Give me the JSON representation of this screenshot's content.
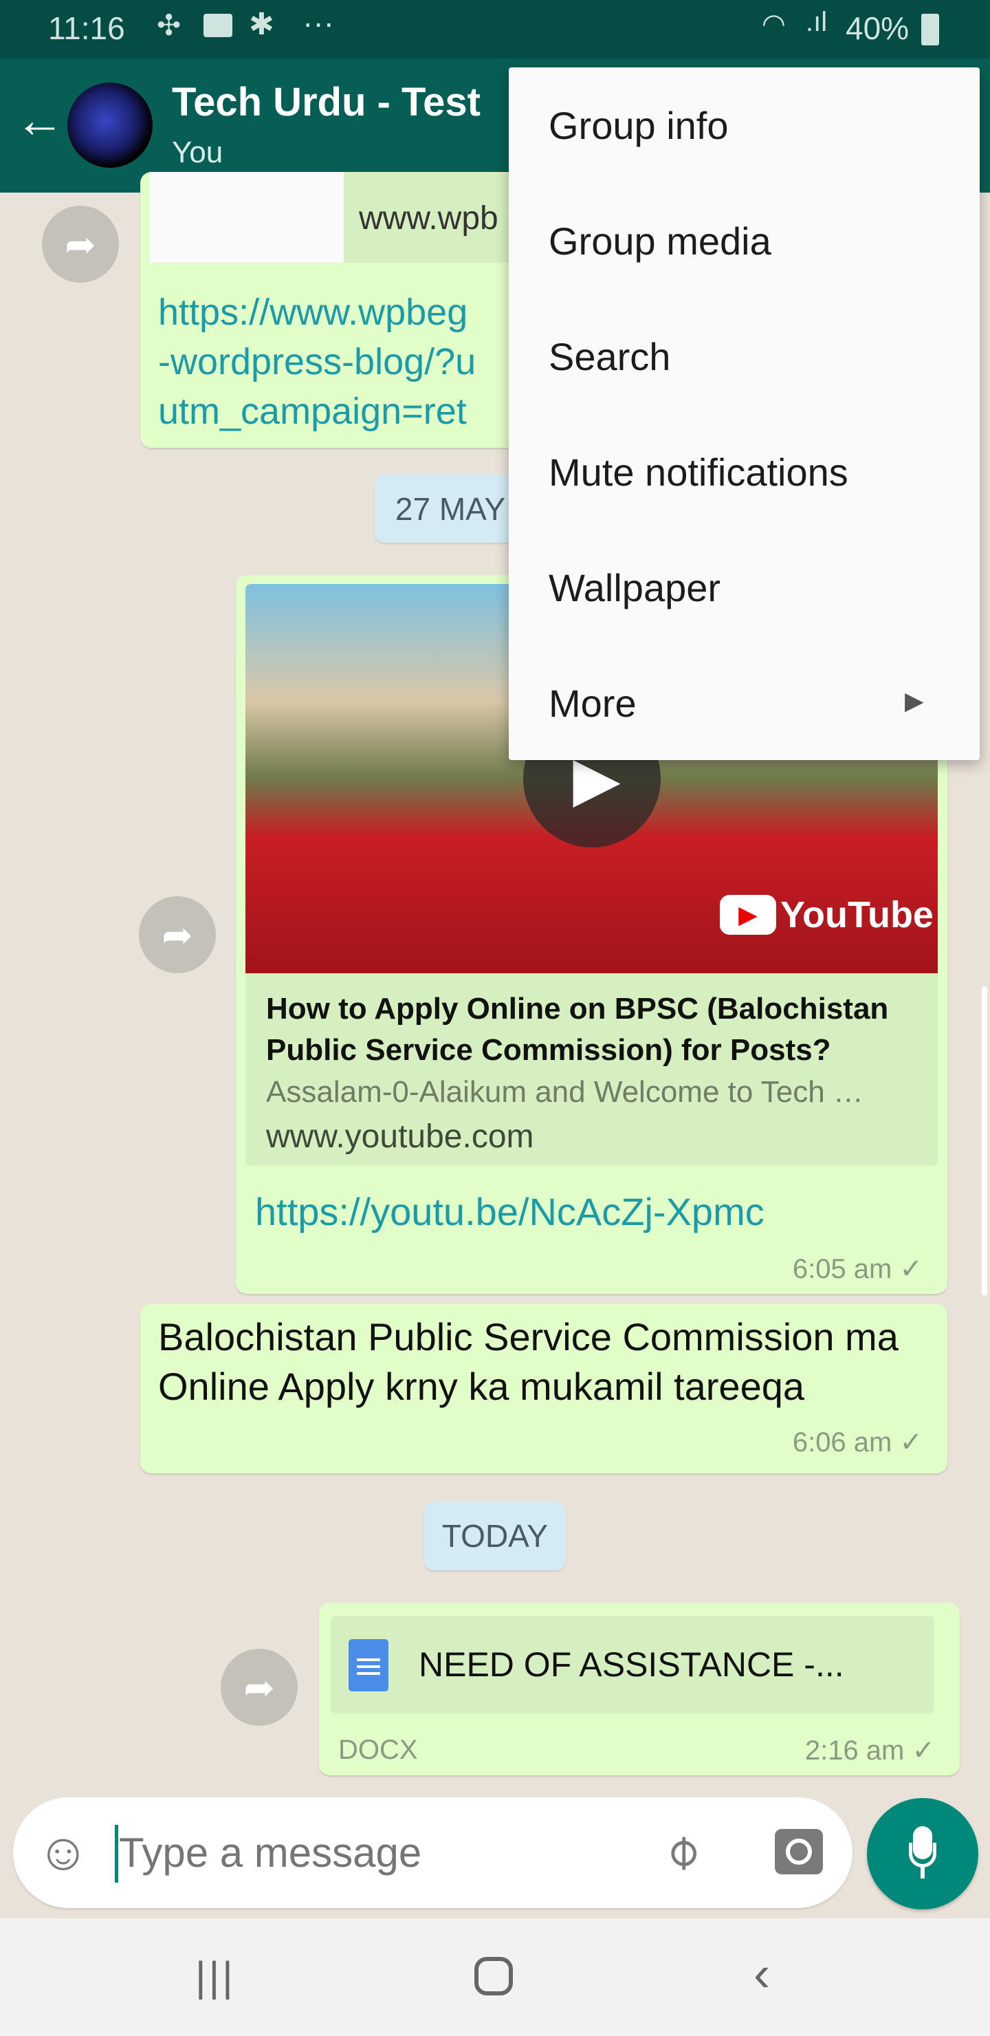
{
  "status_bar": {
    "time": "11:16",
    "battery": "40%",
    "icons": [
      "pinwheel-icon",
      "gmail-icon",
      "gear-icon",
      "more-dots-icon",
      "wifi-icon",
      "signal-icon",
      "battery-icon"
    ]
  },
  "header": {
    "title": "Tech Urdu - Test",
    "subtitle": "You"
  },
  "menu": {
    "items": [
      {
        "label": "Group info"
      },
      {
        "label": "Group media"
      },
      {
        "label": "Search"
      },
      {
        "label": "Mute notifications"
      },
      {
        "label": "Wallpaper"
      },
      {
        "label": "More"
      }
    ]
  },
  "messages": {
    "m1": {
      "preview_domain": "www.wpb",
      "link_lines": [
        "https://www.wpbeg",
        "-wordpress-blog/?u",
        "utm_campaign=ret"
      ]
    },
    "date1": "27 MAY",
    "m2": {
      "preview_title": "How to Apply Online on BPSC (Balochistan Public Service Commission) for Posts?",
      "preview_desc": "Assalam-0-Alaikum and Welcome to Tech …",
      "preview_domain": "www.youtube.com",
      "thumb_brand": "YouTube",
      "link": "https://youtu.be/NcAcZj-Xpmc",
      "time": "6:05 am",
      "tick": "✓"
    },
    "m3": {
      "text": "Balochistan Public Service Commission ma Online Apply krny ka mukamil tareeqa",
      "time": "6:06 am",
      "tick": "✓"
    },
    "date2": "TODAY",
    "m4": {
      "doc_name": "NEED OF ASSISTANCE  -...",
      "doc_type": "DOCX",
      "time": "2:16 am",
      "tick": "✓"
    }
  },
  "composer": {
    "placeholder": "Type a message"
  },
  "colors": {
    "header": "#075e54",
    "status": "#054d44",
    "bubble": "#e1fdc8",
    "accent": "#00897b",
    "link": "#1b9aa8"
  }
}
